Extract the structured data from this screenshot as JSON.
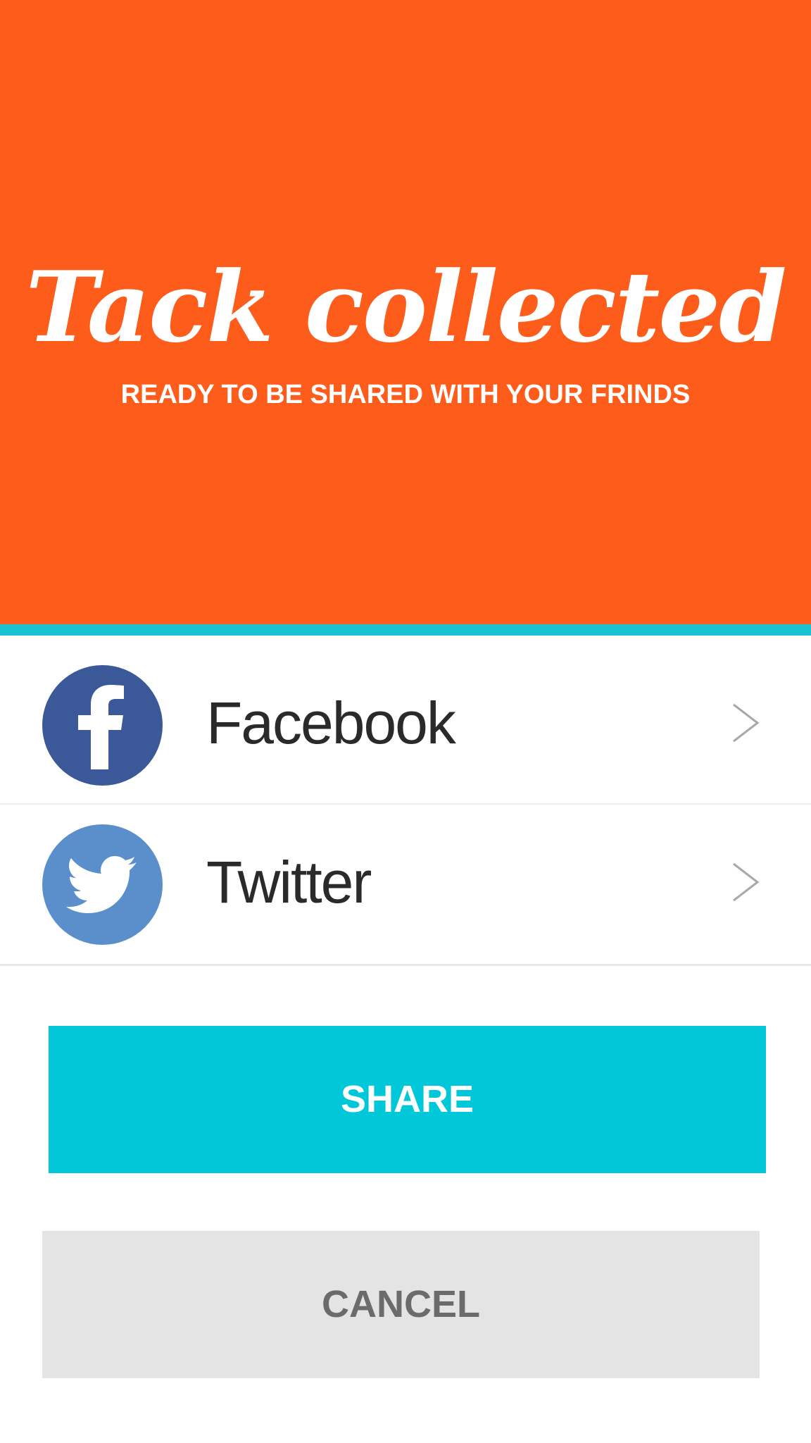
{
  "hero": {
    "title": "Tack collected",
    "subtitle": "READY TO BE SHARED WITH YOUR FRINDS",
    "background_color": "#fd5c1b"
  },
  "accent_color": "#1ac3d1",
  "share_options": [
    {
      "label": "Facebook",
      "icon": "facebook-icon",
      "icon_color": "#3b5998",
      "chevron": "chevron-right-icon"
    },
    {
      "label": "Twitter",
      "icon": "twitter-icon",
      "icon_color": "#5b8fcb",
      "chevron": "chevron-right-icon"
    }
  ],
  "buttons": {
    "share_label": "SHARE",
    "share_color": "#00c8d8",
    "cancel_label": "CANCEL",
    "cancel_color": "#e4e4e4"
  }
}
